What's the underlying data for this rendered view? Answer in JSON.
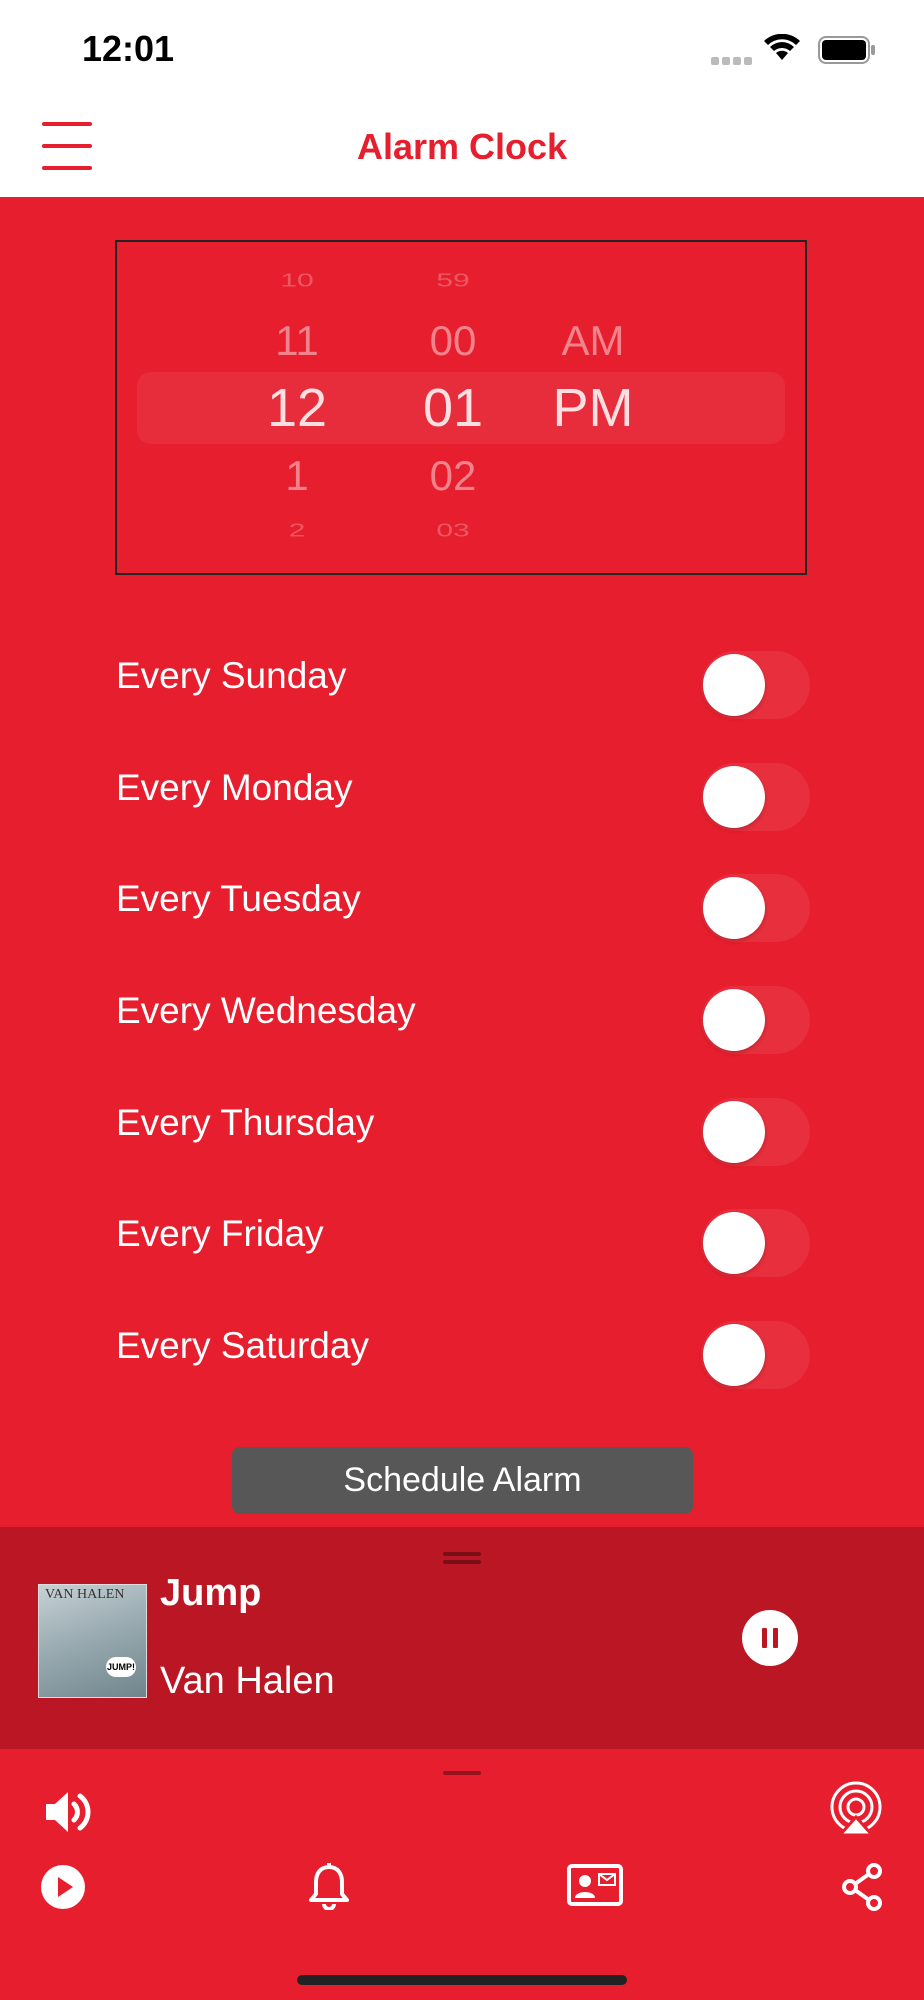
{
  "status_bar": {
    "time": "12:01"
  },
  "nav": {
    "title": "Alarm Clock",
    "menu_icon": "hamburger-menu-icon"
  },
  "picker": {
    "hours": [
      "10",
      "11",
      "12",
      "1",
      "2"
    ],
    "minutes": [
      "59",
      "00",
      "01",
      "02",
      "03"
    ],
    "periods": [
      "AM",
      "PM"
    ],
    "selected": {
      "hour": "12",
      "minute": "01",
      "period": "PM"
    }
  },
  "days": [
    {
      "label": "Every Sunday",
      "on": false
    },
    {
      "label": "Every Monday",
      "on": false
    },
    {
      "label": "Every Tuesday",
      "on": false
    },
    {
      "label": "Every Wednesday",
      "on": false
    },
    {
      "label": "Every Thursday",
      "on": false
    },
    {
      "label": "Every Friday",
      "on": false
    },
    {
      "label": "Every Saturday",
      "on": false
    }
  ],
  "schedule_button": "Schedule Alarm",
  "now_playing": {
    "track": "Jump",
    "artist": "Van Halen",
    "album_text": "VAN HALEN",
    "album_bubble": "JUMP!"
  },
  "toolbar": {
    "icons": [
      "volume-icon",
      "airplay-icon",
      "play-icon",
      "bell-icon",
      "contact-card-icon",
      "share-icon"
    ]
  },
  "colors": {
    "accent": "#E61E2D",
    "player_bg": "#BA1624",
    "button_bg": "#575757"
  }
}
